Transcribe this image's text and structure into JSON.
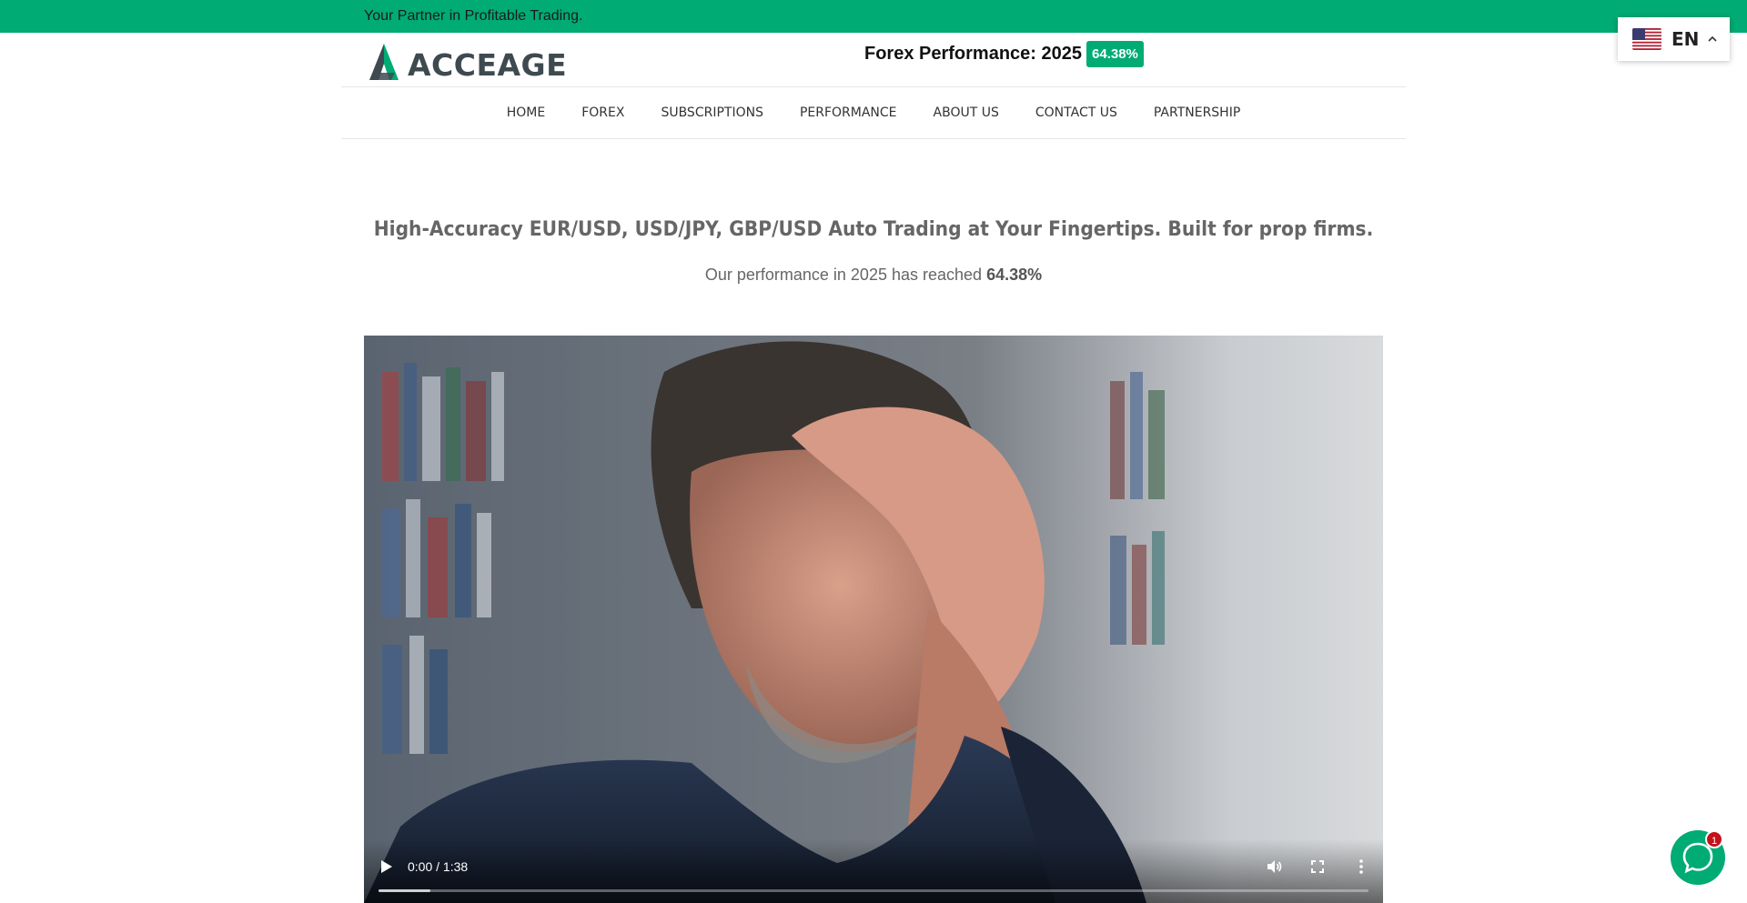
{
  "topbar": {
    "tagline": "Your Partner in Profitable Trading."
  },
  "language": {
    "code": "EN",
    "flag_icon": "us-flag-icon"
  },
  "brand": {
    "name": "ACCEAGE",
    "accent_color": "#00ab74",
    "text_color": "#3e4a50"
  },
  "performance_header": {
    "title": "Forex Performance: 2025",
    "value": "64.38%"
  },
  "nav": {
    "items": [
      {
        "label": "HOME"
      },
      {
        "label": "FOREX"
      },
      {
        "label": "SUBSCRIPTIONS"
      },
      {
        "label": "PERFORMANCE"
      },
      {
        "label": "ABOUT US"
      },
      {
        "label": "CONTACT US"
      },
      {
        "label": "PARTNERSHIP"
      }
    ]
  },
  "hero": {
    "headline": "High-Accuracy EUR/USD, USD/JPY, GBP/USD Auto Trading at Your Fingertips. Built for prop firms.",
    "subline_prefix": "Our performance in 2025 has reached",
    "subline_value": "64.38%"
  },
  "video": {
    "time": "0:00 / 1:38",
    "buffered_fraction": 0.052
  },
  "chat": {
    "unread_count": "1",
    "icon": "chat-bubble-icon"
  }
}
